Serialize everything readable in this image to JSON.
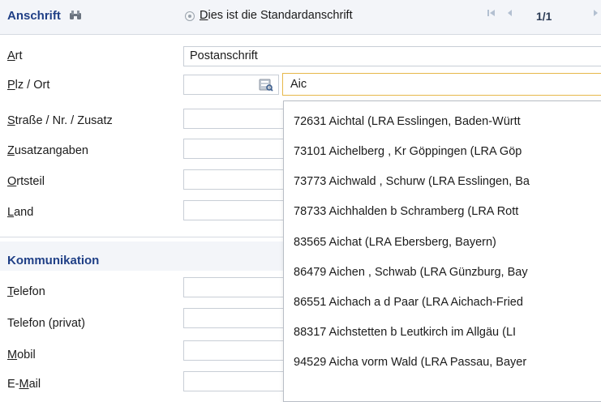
{
  "anschrift": {
    "title": "Anschrift",
    "icon": "binoculars-icon",
    "standard_radio": {
      "accel": "D",
      "rest": "ies ist die Standardanschrift"
    },
    "pager": {
      "first": "first-page-icon",
      "prev": "previous-page-icon",
      "position": "1/1",
      "next": "next-page-icon"
    }
  },
  "fields": {
    "art": {
      "accel": "A",
      "rest": "rt",
      "value": "Postanschrift"
    },
    "plz_ort": {
      "accel": "P",
      "rest": "lz / Ort",
      "plz_value": "",
      "ort_value": "Aic",
      "lookup_icon": "address-book-icon"
    },
    "strasse": {
      "accel": "S",
      "rest": "traße / Nr. / Zusatz"
    },
    "zusatzangaben": {
      "accel": "Z",
      "rest": "usatzangaben"
    },
    "ortsteil": {
      "accel": "O",
      "rest": "rtsteil"
    },
    "land": {
      "accel": "L",
      "rest": "and"
    }
  },
  "kommunikation": {
    "title": "Kommunikation",
    "telefon": {
      "accel": "T",
      "rest": "elefon"
    },
    "telefon_privat": {
      "label": "Telefon (privat)"
    },
    "mobil": {
      "accel": "M",
      "rest": "obil"
    },
    "email": {
      "pre": "E-",
      "accel": "M",
      "rest": "ail"
    }
  },
  "autocomplete": [
    "72631 Aichtal (LRA Esslingen, Baden-Württ",
    "73101 Aichelberg , Kr Göppingen (LRA Göp",
    "73773 Aichwald , Schurw (LRA Esslingen, Ba",
    "78733 Aichhalden b Schramberg (LRA Rott",
    "83565 Aichat (LRA Ebersberg, Bayern)",
    "86479 Aichen , Schwab (LRA Günzburg, Bay",
    "86551 Aichach a d Paar (LRA Aichach-Fried",
    "88317 Aichstetten b Leutkirch im Allgäu (LI",
    "94529 Aicha vorm Wald (LRA Passau, Bayer"
  ],
  "colors": {
    "section_title": "#1f3f86",
    "field_border": "#c8ced6",
    "active_border": "#e6b84a",
    "band": "#f3f5f9"
  }
}
